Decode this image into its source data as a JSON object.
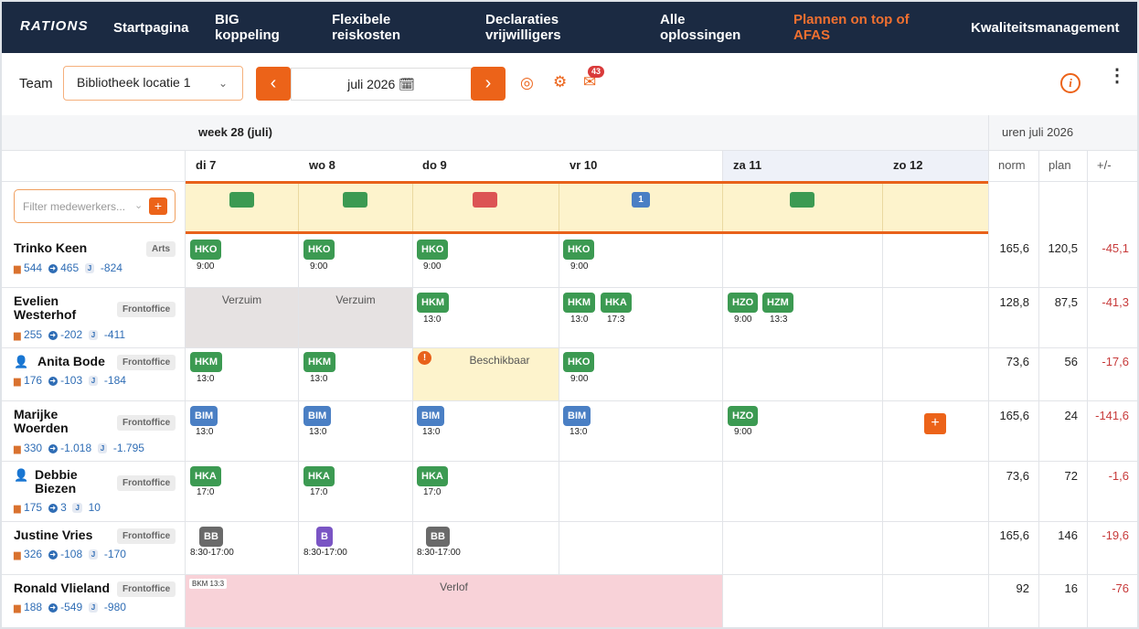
{
  "nav": {
    "logo": "RATIONS",
    "items": [
      {
        "line1": "Startpagina",
        "line2": ""
      },
      {
        "line1": "BIG",
        "line2": "koppeling"
      },
      {
        "line1": "Flexibele",
        "line2": "reiskosten"
      },
      {
        "line1": "Declaraties",
        "line2": "vrijwilligers"
      },
      {
        "line1": "Alle",
        "line2": "oplossingen"
      },
      {
        "line1": "Plannen on top of",
        "line2": "AFAS"
      },
      {
        "line1": "Kwaliteitsmanagement",
        "line2": ""
      }
    ],
    "active_color": "#f07030"
  },
  "toolbar": {
    "team_label": "Team",
    "team_value": "Bibliotheek locatie 1",
    "prev": "‹",
    "next": "›",
    "month": "juli 2026 🗓",
    "mail_badge": "43",
    "icons": [
      "target-icon",
      "gear-icon",
      "mail-icon",
      "info-icon",
      "more-icon"
    ],
    "info": "i",
    "more": "⋮"
  },
  "grid": {
    "week_label": "week 28 (juli)",
    "hours_label": "uren juli 2026",
    "days": [
      "di 7",
      "wo 8",
      "do 9",
      "vr 10",
      "za 11",
      "zo 12"
    ],
    "sum_headers": [
      "norm",
      "plan",
      "+/-"
    ],
    "filter_placeholder": "Filter medewerkers...",
    "indicator_count": "1"
  },
  "employees": [
    {
      "name_1": "Trinko Keen",
      "name_2": "",
      "role": "Arts",
      "s1": "544",
      "s2": "465",
      "s3": "-824",
      "norm": "165,6",
      "plan": "120,5",
      "diff": "-45,1"
    },
    {
      "name_1": "Evelien",
      "name_2": "Westerhof",
      "role": "Frontoffice",
      "s1": "255",
      "s2": "-202",
      "s3": "-411",
      "norm": "128,8",
      "plan": "87,5",
      "diff": "-41,3"
    },
    {
      "name_1": "Anita Bode",
      "name_2": "",
      "role": "Frontoffice",
      "s1": "176",
      "s2": "-103",
      "s3": "-184",
      "norm": "73,6",
      "plan": "56",
      "diff": "-17,6"
    },
    {
      "name_1": "Marijke",
      "name_2": "Woerden",
      "role": "Frontoffice",
      "s1": "330",
      "s2": "-1.018",
      "s3": "-1.795",
      "norm": "165,6",
      "plan": "24",
      "diff": "-141,6"
    },
    {
      "name_1": "Debbie",
      "name_2": "Biezen",
      "role": "Frontoffice",
      "s1": "175",
      "s2": "3",
      "s3": "10",
      "norm": "73,6",
      "plan": "72",
      "diff": "-1,6"
    },
    {
      "name_1": "Justine Vries",
      "name_2": "",
      "role": "Frontoffice",
      "s1": "326",
      "s2": "-108",
      "s3": "-170",
      "norm": "165,6",
      "plan": "146",
      "diff": "-19,6"
    },
    {
      "name_1": "Ronald Vlieland",
      "name_2": "",
      "role": "Frontoffice",
      "s1": "188",
      "s2": "-549",
      "s3": "-980",
      "norm": "92",
      "plan": "16",
      "diff": "-76"
    }
  ],
  "shifts": [
    {
      "code": "HKO",
      "time": "9:00"
    },
    {
      "code": "HKO",
      "time": "9:00"
    },
    {
      "code": "HKO",
      "time": "9:00"
    },
    {
      "code": "HKO",
      "time": "9:00"
    },
    {
      "code": "HKM",
      "time": "13:0"
    },
    {
      "code": "HKM",
      "time": "13:0"
    },
    {
      "code": "HKA",
      "time": "17:3"
    },
    {
      "code": "HZO",
      "time": "9:00"
    },
    {
      "code": "HZM",
      "time": "13:3"
    },
    {
      "code": "HKM",
      "time": "13:0"
    },
    {
      "code": "HKM",
      "time": "13:0"
    },
    {
      "code": "HKO",
      "time": "9:00"
    },
    {
      "code": "BIM",
      "time": "13:0"
    },
    {
      "code": "BIM",
      "time": "13:0"
    },
    {
      "code": "BIM",
      "time": "13:0"
    },
    {
      "code": "BIM",
      "time": "13:0"
    },
    {
      "code": "HZO",
      "time": "9:00"
    },
    {
      "code": "HKA",
      "time": "17:0"
    },
    {
      "code": "HKA",
      "time": "17:0"
    },
    {
      "code": "HKA",
      "time": "17:0"
    },
    {
      "code": "BB",
      "time": "8:30-17:00"
    },
    {
      "code": "B",
      "time": "8:30-17:00"
    },
    {
      "code": "BB",
      "time": "8:30-17:00"
    }
  ],
  "blocks": {
    "verzuim": "Verzuim",
    "beschikbaar": "Beschikbaar",
    "verlof": "Verlof",
    "bkm": "BKM 13:3",
    "alert": "!",
    "add": "+"
  },
  "colors": {
    "accent": "#ec6319",
    "nav_bg": "#1b2a42",
    "shift_green": "#3c9a52",
    "shift_blue": "#4a7fc4",
    "negative": "#c73a3a"
  }
}
